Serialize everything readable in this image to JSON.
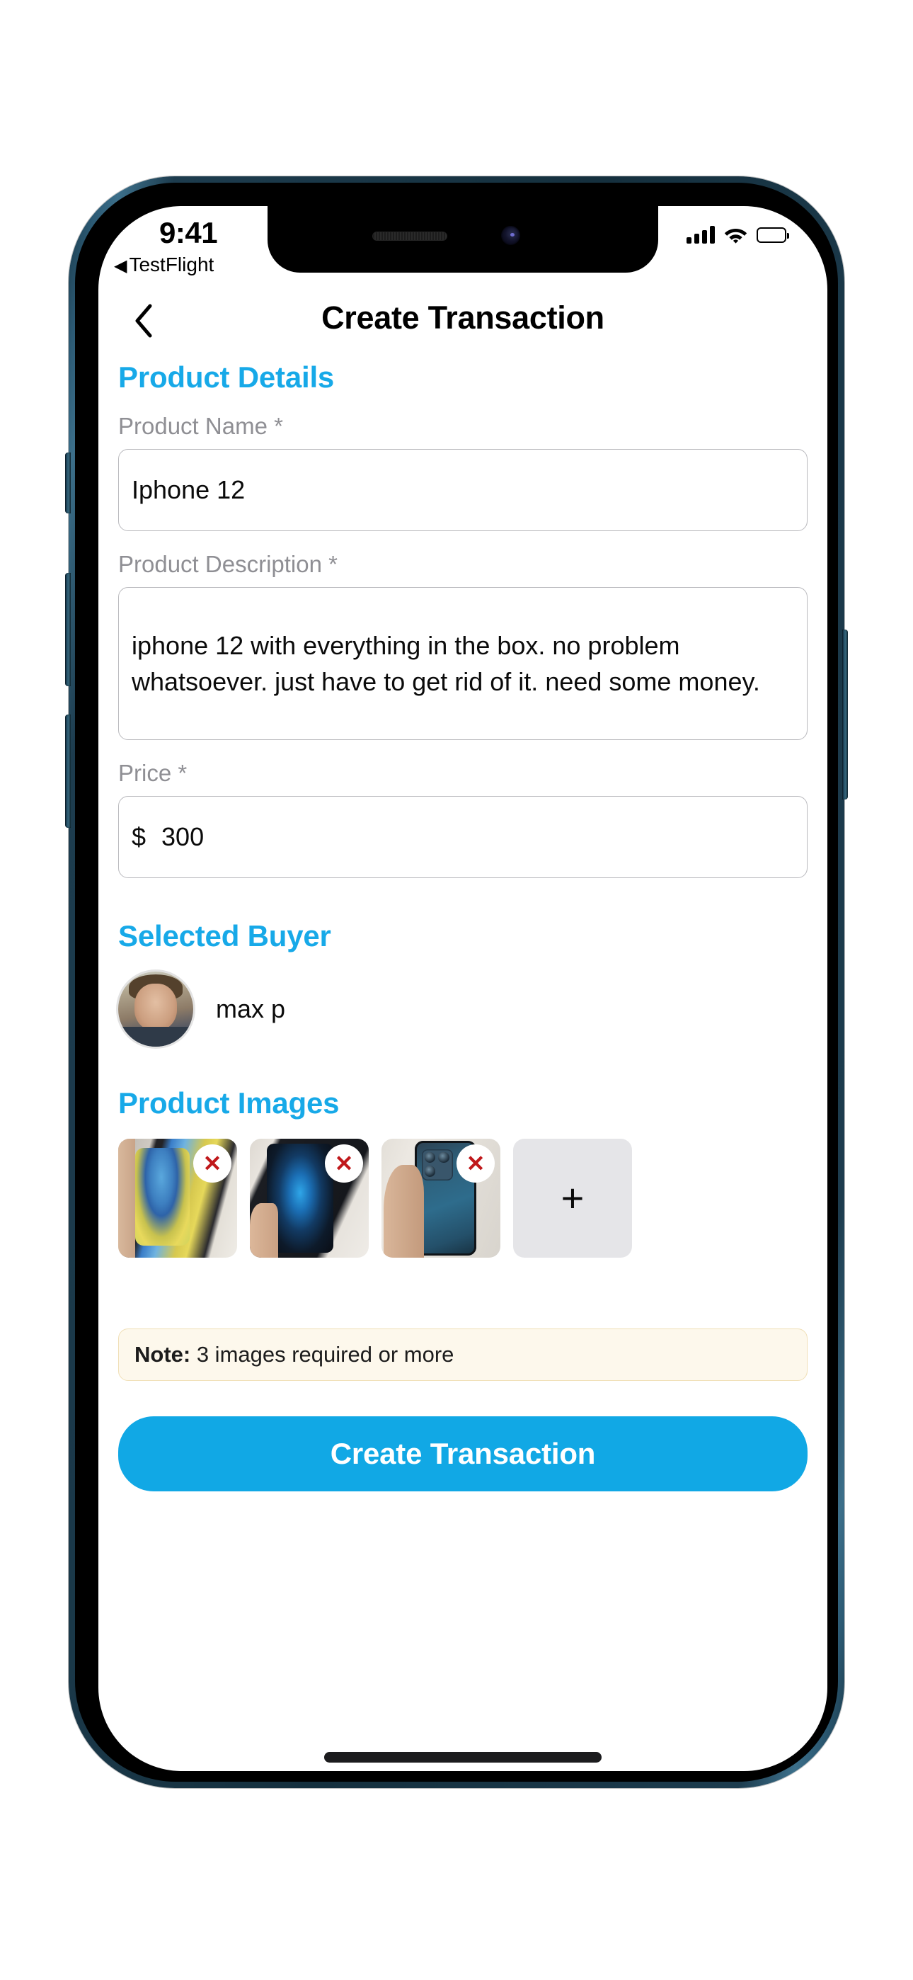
{
  "status_bar": {
    "time": "9:41",
    "back_app_label": "TestFlight",
    "back_app_arrow": "◀",
    "signal_icon": "cellular-signal-icon",
    "wifi_icon": "wifi-icon",
    "battery_icon": "battery-full-icon"
  },
  "navbar": {
    "back_icon": "chevron-left-icon",
    "title": "Create Transaction"
  },
  "product_details": {
    "section_title": "Product Details",
    "name_label": "Product Name *",
    "name_value": "Iphone 12",
    "description_label": "Product Description *",
    "description_value": "iphone 12 with everything in the box. no problem whatsoever. just have to get rid of it. need some money.",
    "price_label": "Price *",
    "price_symbol": "$",
    "price_value": "300"
  },
  "selected_buyer": {
    "section_title": "Selected Buyer",
    "avatar_alt": "buyer-avatar",
    "name": "max p"
  },
  "product_images": {
    "section_title": "Product Images",
    "remove_glyph": "✕",
    "add_glyph": "+",
    "items": [
      {
        "alt": "iphone-lockscreen-photo",
        "remove_label": "remove-image-1"
      },
      {
        "alt": "iphone-in-box-photo",
        "remove_label": "remove-image-2"
      },
      {
        "alt": "iphone-back-in-hand-photo",
        "remove_label": "remove-image-3"
      }
    ],
    "add_button_label": "add-image"
  },
  "note": {
    "prefix": "Note:",
    "text": " 3 images required or more"
  },
  "cta": {
    "label": "Create Transaction"
  },
  "colors": {
    "accent_blue": "#17a9e8",
    "button_blue": "#11a8e5",
    "label_gray": "#8f8f94",
    "note_bg": "#fdf8ec",
    "note_border": "#f0dfb6",
    "remove_red": "#c0181b",
    "device_frame": "#1d3c4e"
  }
}
